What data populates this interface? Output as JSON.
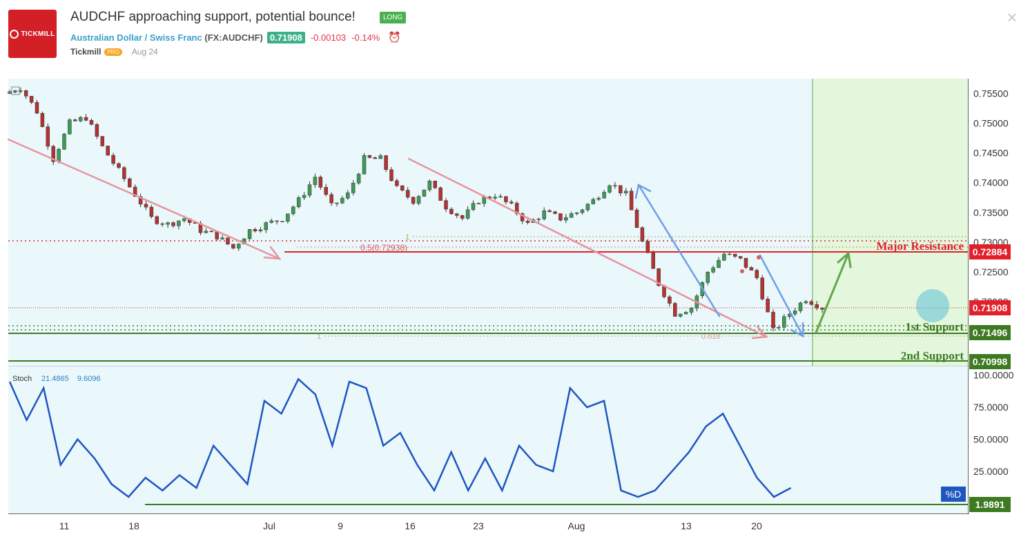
{
  "header": {
    "logo_text": "TICKMILL",
    "title": "AUDCHF approaching support, potential bounce!",
    "badge": "LONG",
    "symbol_name": "Australian Dollar / Swiss Franc",
    "ticker": "(FX:AUDCHF)",
    "price": "0.71908",
    "change": "-0.00103",
    "change_pct": "-0.14%",
    "author": "Tickmill",
    "author_badge": "PRO",
    "date": "Aug 24",
    "close_icon": "close-icon",
    "alarm_icon": "alarm-clock-icon"
  },
  "colors": {
    "chart_bg": "#eaf8fc",
    "forecast_bg": "#e2f7dc",
    "resistance": "#e0202a",
    "support": "#3d7a22",
    "trend_pink": "#e8949c",
    "blue_arrow": "#6c9ee8",
    "green_arrow": "#63a54a",
    "stoch": "#1f55c0",
    "bull": "#3e9a55",
    "bear": "#b33232"
  },
  "chart_data": {
    "type": "candlestick",
    "main_axis": {
      "ticks": [
        "0.75500",
        "0.75000",
        "0.74500",
        "0.74000",
        "0.73500",
        "0.73000",
        "0.72500",
        "0.72000"
      ],
      "ylim": [
        0.7092,
        0.7575
      ]
    },
    "x_ticks": [
      "11",
      "18",
      "Jul",
      "9",
      "16",
      "23",
      "Aug",
      "13",
      "20"
    ],
    "price_path": [
      [
        0,
        0.755
      ],
      [
        3,
        0.756
      ],
      [
        6,
        0.752
      ],
      [
        9,
        0.744
      ],
      [
        12,
        0.75
      ],
      [
        15,
        0.751
      ],
      [
        18,
        0.746
      ],
      [
        21,
        0.742
      ],
      [
        24,
        0.738
      ],
      [
        27,
        0.734
      ],
      [
        30,
        0.733
      ],
      [
        33,
        0.734
      ],
      [
        36,
        0.732
      ],
      [
        39,
        0.731
      ],
      [
        42,
        0.729
      ],
      [
        45,
        0.732
      ],
      [
        48,
        0.733
      ],
      [
        51,
        0.734
      ],
      [
        54,
        0.737
      ],
      [
        57,
        0.741
      ],
      [
        60,
        0.736
      ],
      [
        63,
        0.738
      ],
      [
        66,
        0.744
      ],
      [
        69,
        0.744
      ],
      [
        72,
        0.739
      ],
      [
        75,
        0.737
      ],
      [
        78,
        0.74
      ],
      [
        81,
        0.736
      ],
      [
        84,
        0.734
      ],
      [
        87,
        0.737
      ],
      [
        90,
        0.738
      ],
      [
        93,
        0.736
      ],
      [
        96,
        0.733
      ],
      [
        99,
        0.735
      ],
      [
        102,
        0.734
      ],
      [
        105,
        0.735
      ],
      [
        108,
        0.737
      ],
      [
        111,
        0.74
      ],
      [
        114,
        0.738
      ],
      [
        117,
        0.73
      ],
      [
        120,
        0.723
      ],
      [
        123,
        0.718
      ],
      [
        126,
        0.719
      ],
      [
        129,
        0.725
      ],
      [
        132,
        0.728
      ],
      [
        135,
        0.727
      ],
      [
        138,
        0.724
      ],
      [
        141,
        0.715
      ],
      [
        144,
        0.718
      ],
      [
        147,
        0.7205
      ],
      [
        150,
        0.719
      ]
    ],
    "levels": [
      {
        "name": "Major Resistance",
        "value": 0.72884,
        "label": "0.72884"
      },
      {
        "name": "1st Support",
        "value": 0.71496,
        "label": "0.71496"
      },
      {
        "name": "2nd Support",
        "value": 0.70998,
        "label": "0.70998"
      },
      {
        "name": "Current",
        "value": 0.71908,
        "label": "0.71908"
      }
    ],
    "fib_labels": [
      "1",
      "0.5(0.72938)",
      "1",
      "0.618"
    ],
    "stochastic": {
      "label": "Stoch",
      "k_value": "21.4865",
      "d_value": "9.6096",
      "ticks": [
        "100.0000",
        "75.0000",
        "50.0000",
        "25.0000"
      ],
      "ylim": [
        -2,
        102
      ],
      "last_label": "1.9891",
      "last_value": 1.9891,
      "d_tag": "%D",
      "path": [
        [
          0,
          95
        ],
        [
          3,
          65
        ],
        [
          6,
          90
        ],
        [
          9,
          30
        ],
        [
          12,
          50
        ],
        [
          15,
          35
        ],
        [
          18,
          15
        ],
        [
          21,
          5
        ],
        [
          24,
          20
        ],
        [
          27,
          10
        ],
        [
          30,
          22
        ],
        [
          33,
          12
        ],
        [
          36,
          45
        ],
        [
          39,
          30
        ],
        [
          42,
          15
        ],
        [
          45,
          80
        ],
        [
          48,
          70
        ],
        [
          51,
          97
        ],
        [
          54,
          85
        ],
        [
          57,
          45
        ],
        [
          60,
          95
        ],
        [
          63,
          90
        ],
        [
          66,
          45
        ],
        [
          69,
          55
        ],
        [
          72,
          30
        ],
        [
          75,
          10
        ],
        [
          78,
          40
        ],
        [
          81,
          10
        ],
        [
          84,
          35
        ],
        [
          87,
          10
        ],
        [
          90,
          45
        ],
        [
          93,
          30
        ],
        [
          96,
          25
        ],
        [
          99,
          90
        ],
        [
          102,
          75
        ],
        [
          105,
          80
        ],
        [
          108,
          10
        ],
        [
          111,
          5
        ],
        [
          114,
          10
        ],
        [
          117,
          25
        ],
        [
          120,
          40
        ],
        [
          123,
          60
        ],
        [
          126,
          70
        ],
        [
          129,
          45
        ],
        [
          132,
          20
        ],
        [
          135,
          5
        ],
        [
          138,
          12
        ]
      ]
    },
    "labels": {
      "major_resistance": "Major Resistance",
      "first_support": "1st Support",
      "second_support": "2nd Support"
    }
  }
}
